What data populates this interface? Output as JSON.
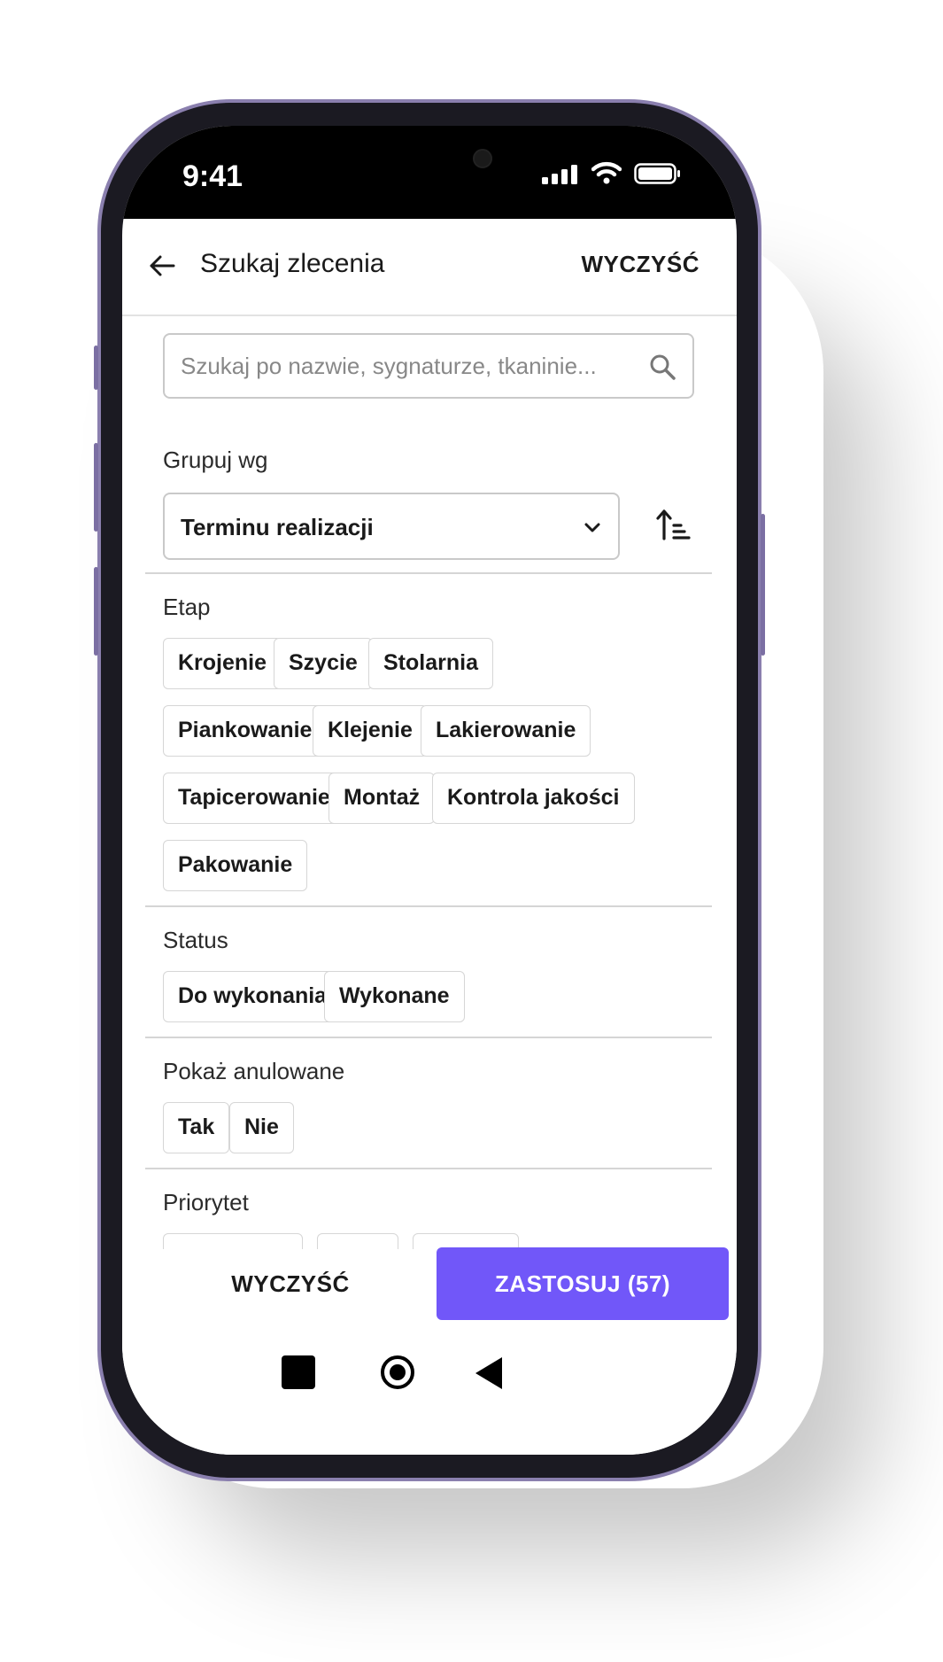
{
  "status_bar": {
    "time": "9:41"
  },
  "app_bar": {
    "title": "Szukaj zlecenia",
    "clear_label": "WYCZYŚĆ"
  },
  "search": {
    "placeholder": "Szukaj po nazwie, sygnaturze, tkaninie..."
  },
  "group_by": {
    "label": "Grupuj wg",
    "selected": "Terminu realizacji"
  },
  "etap": {
    "label": "Etap",
    "chips": [
      "Krojenie",
      "Szycie",
      "Stolarnia",
      "Piankowanie",
      "Klejenie",
      "Lakierowanie",
      "Tapicerowanie",
      "Montaż",
      "Kontrola jakości",
      "Pakowanie"
    ]
  },
  "status": {
    "label": "Status",
    "chips": [
      "Do wykonania",
      "Wykonane"
    ]
  },
  "cancelled": {
    "label": "Pokaż anulowane",
    "chips": [
      "Tak",
      "Nie"
    ]
  },
  "priority": {
    "label": "Priorytet"
  },
  "footer": {
    "clear_label": "WYCZYŚĆ",
    "apply_label": "ZASTOSUJ (57)"
  },
  "colors": {
    "accent": "#7157f9",
    "frame": "#8a7fae"
  },
  "icons": [
    "back-arrow-icon",
    "search-icon",
    "chevron-down-icon",
    "sort-ascending-icon",
    "signal-icon",
    "wifi-icon",
    "battery-icon",
    "nav-recents-icon",
    "nav-home-icon",
    "nav-back-icon"
  ]
}
